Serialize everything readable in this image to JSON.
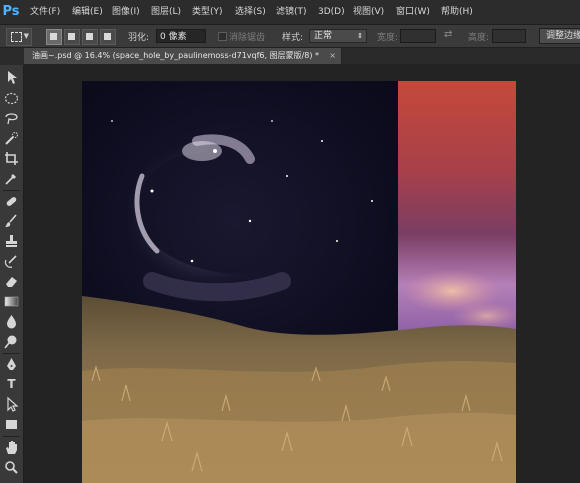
{
  "app": {
    "logo": "Ps",
    "menus": [
      "文件(F)",
      "编辑(E)",
      "图像(I)",
      "图层(L)",
      "类型(Y)",
      "选择(S)",
      "滤镜(T)",
      "3D(D)",
      "视图(V)",
      "窗口(W)",
      "帮助(H)"
    ]
  },
  "options": {
    "feather_label": "羽化:",
    "feather_value": "0 像素",
    "antialias_label": "消除锯齿",
    "style_label": "样式:",
    "style_value": "正常",
    "width_label": "宽度:",
    "height_label": "高度:",
    "refine_button": "调整边缘"
  },
  "document": {
    "tab_title": "油画~.psd @ 16.4% (space_hole_by_paulinemoss-d71vqf6, 图层蒙版/8) *",
    "close_glyph": "×"
  },
  "toolbox": {
    "tools": [
      "move-icon",
      "elliptical-marquee-icon",
      "lasso-icon",
      "quick-selection-icon",
      "crop-icon",
      "eyedropper-icon",
      "spot-healing-icon",
      "brush-icon",
      "clone-stamp-icon",
      "history-brush-icon",
      "eraser-icon",
      "gradient-icon",
      "blur-icon",
      "dodge-icon",
      "pen-icon",
      "type-icon",
      "path-selection-icon",
      "rectangle-icon",
      "hand-icon",
      "zoom-icon"
    ],
    "type_glyph": "T"
  },
  "colors": {
    "accent": "#4fb3ff",
    "space": "#0b0b1c",
    "sunset_top": "#c44a3a",
    "sunset_bottom": "#9a6fb8",
    "grass": "#8a7248"
  }
}
